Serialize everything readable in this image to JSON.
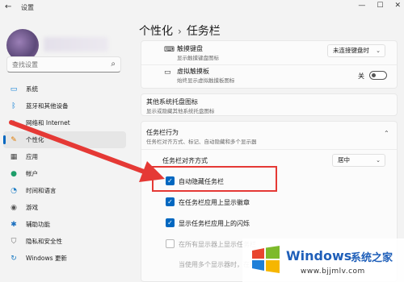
{
  "window": {
    "title": "设置",
    "back_icon": "arrow-left-icon",
    "controls": {
      "minimize": "—",
      "maximize": "☐",
      "close": "✕"
    }
  },
  "sidebar": {
    "search": {
      "placeholder": "查找设置",
      "icon": "search-icon"
    },
    "items": [
      {
        "label": "系统",
        "icon": "monitor-icon",
        "glyph": "▭",
        "color": "#0078d4"
      },
      {
        "label": "蓝牙和其他设备",
        "icon": "bluetooth-icon",
        "glyph": "ᛒ",
        "color": "#0078d4"
      },
      {
        "label": "网络和 Internet",
        "icon": "wifi-icon",
        "glyph": "◆",
        "color": "#0067c0"
      },
      {
        "label": "个性化",
        "icon": "brush-icon",
        "glyph": "✎",
        "color": "#e07a00",
        "active": true
      },
      {
        "label": "应用",
        "icon": "apps-icon",
        "glyph": "▦",
        "color": "#444"
      },
      {
        "label": "帐户",
        "icon": "person-icon",
        "glyph": "●",
        "color": "#1e9e6a"
      },
      {
        "label": "时间和语言",
        "icon": "globe-clock-icon",
        "glyph": "◔",
        "color": "#1a7bc4"
      },
      {
        "label": "游戏",
        "icon": "gamepad-icon",
        "glyph": "◉",
        "color": "#555"
      },
      {
        "label": "辅助功能",
        "icon": "accessibility-icon",
        "glyph": "✱",
        "color": "#1a6fbf"
      },
      {
        "label": "隐私和安全性",
        "icon": "shield-icon",
        "glyph": "⛉",
        "color": "#6b6b6b"
      },
      {
        "label": "Windows 更新",
        "icon": "sync-icon",
        "glyph": "↻",
        "color": "#1a7bc4"
      }
    ]
  },
  "header": {
    "parent": "个性化",
    "separator": "›",
    "current": "任务栏"
  },
  "content": {
    "touch_keyboard": {
      "title": "触摸键盘",
      "subtitle": "显示触摸键盘图标",
      "value": "未连接键盘时",
      "icon": "keyboard-icon"
    },
    "virtual_touchpad": {
      "title": "虚拟触摸板",
      "subtitle": "始终显示虚拟触摸板图标",
      "state_label": "关",
      "icon": "touchpad-icon"
    },
    "other_tray": {
      "title": "其他系统托盘图标",
      "subtitle": "显示或隐藏其他系统托盘图标"
    },
    "behaviors": {
      "title": "任务栏行为",
      "subtitle": "任务栏对齐方式、标记、自动隐藏和多个显示器",
      "alignment_label": "任务栏对齐方式",
      "alignment_value": "居中",
      "options": [
        {
          "label": "自动隐藏任务栏",
          "checked": true,
          "enabled": true
        },
        {
          "label": "在任务栏应用上显示徽章",
          "checked": true,
          "enabled": true
        },
        {
          "label": "显示任务栏应用上的闪烁",
          "checked": true,
          "enabled": true
        },
        {
          "label": "在所有显示器上显示任务栏",
          "checked": false,
          "enabled": false
        },
        {
          "label": "当使用多个显示器时，在以下位置",
          "checked": false,
          "enabled": false
        }
      ]
    }
  },
  "watermark": {
    "brand": "Windows",
    "brand_cn": "系统之家",
    "url": "www.bjjmlv.com"
  },
  "colors": {
    "accent": "#0067c0",
    "annotation": "#e53935"
  }
}
